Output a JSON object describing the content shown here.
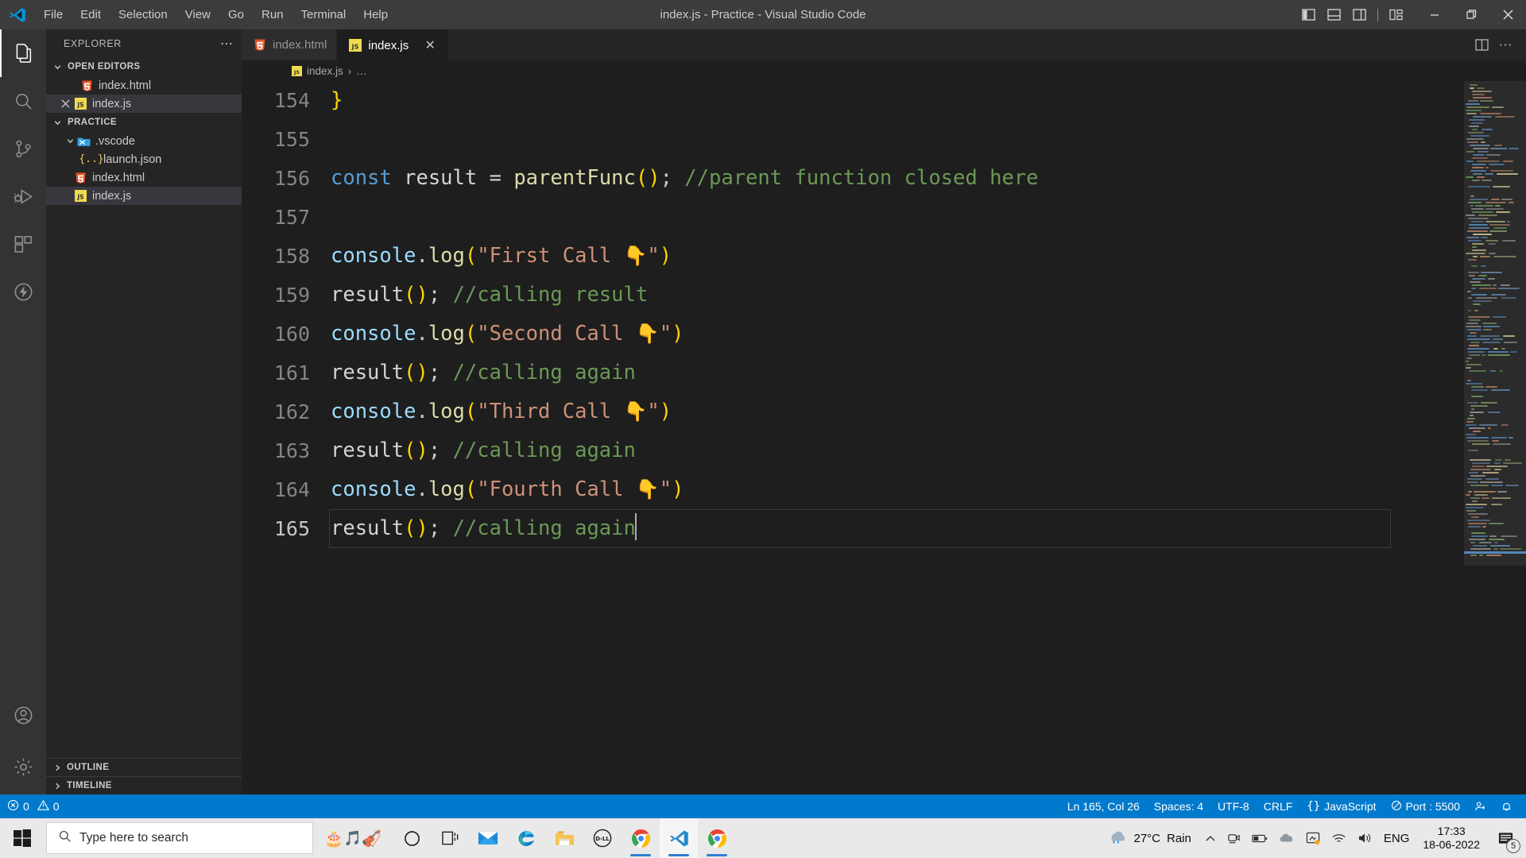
{
  "window": {
    "title": "index.js - Practice - Visual Studio Code",
    "logo_icon": "vscode-logo-icon",
    "menus": [
      "File",
      "Edit",
      "Selection",
      "View",
      "Go",
      "Run",
      "Terminal",
      "Help"
    ],
    "layout_buttons": [
      {
        "name": "toggle-primary-sidebar-icon",
        "label": "panel-left"
      },
      {
        "name": "toggle-panel-icon",
        "label": "panel-bottom"
      },
      {
        "name": "toggle-secondary-sidebar-icon",
        "label": "panel-right"
      },
      {
        "name": "customize-layout-icon",
        "label": "layout"
      }
    ],
    "controls": [
      {
        "name": "minimize-button",
        "glyph": "—"
      },
      {
        "name": "maximize-button",
        "glyph": "❐"
      },
      {
        "name": "close-button",
        "glyph": "✕"
      }
    ]
  },
  "activitybar": {
    "items": [
      {
        "name": "explorer",
        "icon": "files-icon",
        "active": true
      },
      {
        "name": "search",
        "icon": "search-icon",
        "active": false
      },
      {
        "name": "source-control",
        "icon": "source-control-icon",
        "active": false
      },
      {
        "name": "run-and-debug",
        "icon": "run-debug-icon",
        "active": false
      },
      {
        "name": "extensions",
        "icon": "extensions-icon",
        "active": false
      },
      {
        "name": "live-share",
        "icon": "bolt-circle-icon",
        "active": false
      }
    ],
    "bottom": [
      {
        "name": "accounts",
        "icon": "account-icon"
      },
      {
        "name": "manage-settings",
        "icon": "gear-icon"
      }
    ]
  },
  "sidebar": {
    "title": "EXPLORER",
    "more_actions": "⋯",
    "open_editors": {
      "label": "OPEN EDITORS",
      "expanded": true,
      "items": [
        {
          "name": "index.html",
          "icon": "html5-icon",
          "dirty": false,
          "selected": false,
          "has_close": false
        },
        {
          "name": "index.js",
          "icon": "js-icon",
          "dirty": false,
          "selected": true,
          "has_close": true
        }
      ]
    },
    "project": {
      "label": "PRACTICE",
      "expanded": true,
      "items": [
        {
          "name": ".vscode",
          "icon": "folder-open-icon",
          "type": "folder",
          "depth": 1,
          "expanded": true,
          "selected": false
        },
        {
          "name": "launch.json",
          "icon": "json-icon",
          "type": "file",
          "depth": 2,
          "selected": false
        },
        {
          "name": "index.html",
          "icon": "html5-icon",
          "type": "file",
          "depth": 1,
          "selected": false
        },
        {
          "name": "index.js",
          "icon": "js-icon",
          "type": "file",
          "depth": 1,
          "selected": true
        }
      ]
    },
    "panels": [
      {
        "label": "OUTLINE",
        "expanded": false
      },
      {
        "label": "TIMELINE",
        "expanded": false
      }
    ]
  },
  "editor": {
    "tabs": [
      {
        "label": "index.html",
        "icon": "html5-icon",
        "active": false,
        "has_close": false
      },
      {
        "label": "index.js",
        "icon": "js-icon",
        "active": true,
        "has_close": true,
        "close_glyph": "✕"
      }
    ],
    "tab_actions": [
      {
        "name": "split-editor-right-icon"
      },
      {
        "name": "more-actions-icon",
        "glyph": "⋯"
      }
    ],
    "breadcrumbs": [
      {
        "label": "index.js",
        "icon": "js-icon"
      },
      {
        "label": "…",
        "icon": null
      }
    ],
    "breadcrumb_separator": "›",
    "first_visible_line": 154,
    "cursor_line": 165,
    "lines": [
      {
        "n": 154,
        "tokens": [
          {
            "t": "brace",
            "v": "}"
          }
        ]
      },
      {
        "n": 155,
        "tokens": []
      },
      {
        "n": 156,
        "tokens": [
          {
            "t": "key",
            "v": "const"
          },
          {
            "t": "plain",
            "v": " "
          },
          {
            "t": "plain",
            "v": "result"
          },
          {
            "t": "plain",
            "v": " = "
          },
          {
            "t": "fn",
            "v": "parentFunc"
          },
          {
            "t": "paren",
            "v": "()"
          },
          {
            "t": "punc",
            "v": ";"
          },
          {
            "t": "plain",
            "v": " "
          },
          {
            "t": "cmt",
            "v": "//parent function closed here"
          }
        ]
      },
      {
        "n": 157,
        "tokens": []
      },
      {
        "n": 158,
        "tokens": [
          {
            "t": "var",
            "v": "console"
          },
          {
            "t": "punc",
            "v": "."
          },
          {
            "t": "prop",
            "v": "log"
          },
          {
            "t": "paren",
            "v": "("
          },
          {
            "t": "str",
            "v": "\"First Call "
          },
          {
            "t": "emoji",
            "v": "👇"
          },
          {
            "t": "str",
            "v": "\""
          },
          {
            "t": "paren",
            "v": ")"
          }
        ]
      },
      {
        "n": 159,
        "tokens": [
          {
            "t": "plain",
            "v": "result"
          },
          {
            "t": "paren",
            "v": "()"
          },
          {
            "t": "punc",
            "v": ";"
          },
          {
            "t": "plain",
            "v": " "
          },
          {
            "t": "cmt",
            "v": "//calling result"
          }
        ]
      },
      {
        "n": 160,
        "tokens": [
          {
            "t": "var",
            "v": "console"
          },
          {
            "t": "punc",
            "v": "."
          },
          {
            "t": "prop",
            "v": "log"
          },
          {
            "t": "paren",
            "v": "("
          },
          {
            "t": "str",
            "v": "\"Second Call "
          },
          {
            "t": "emoji",
            "v": "👇"
          },
          {
            "t": "str",
            "v": "\""
          },
          {
            "t": "paren",
            "v": ")"
          }
        ]
      },
      {
        "n": 161,
        "tokens": [
          {
            "t": "plain",
            "v": "result"
          },
          {
            "t": "paren",
            "v": "()"
          },
          {
            "t": "punc",
            "v": ";"
          },
          {
            "t": "plain",
            "v": " "
          },
          {
            "t": "cmt",
            "v": "//calling again"
          }
        ]
      },
      {
        "n": 162,
        "tokens": [
          {
            "t": "var",
            "v": "console"
          },
          {
            "t": "punc",
            "v": "."
          },
          {
            "t": "prop",
            "v": "log"
          },
          {
            "t": "paren",
            "v": "("
          },
          {
            "t": "str",
            "v": "\"Third Call "
          },
          {
            "t": "emoji",
            "v": "👇"
          },
          {
            "t": "str",
            "v": "\""
          },
          {
            "t": "paren",
            "v": ")"
          }
        ]
      },
      {
        "n": 163,
        "tokens": [
          {
            "t": "plain",
            "v": "result"
          },
          {
            "t": "paren",
            "v": "()"
          },
          {
            "t": "punc",
            "v": ";"
          },
          {
            "t": "plain",
            "v": " "
          },
          {
            "t": "cmt",
            "v": "//calling again"
          }
        ]
      },
      {
        "n": 164,
        "tokens": [
          {
            "t": "var",
            "v": "console"
          },
          {
            "t": "punc",
            "v": "."
          },
          {
            "t": "prop",
            "v": "log"
          },
          {
            "t": "paren",
            "v": "("
          },
          {
            "t": "str",
            "v": "\"Fourth Call "
          },
          {
            "t": "emoji",
            "v": "👇"
          },
          {
            "t": "str",
            "v": "\""
          },
          {
            "t": "paren",
            "v": ")"
          }
        ]
      },
      {
        "n": 165,
        "tokens": [
          {
            "t": "plain",
            "v": "result"
          },
          {
            "t": "paren",
            "v": "()"
          },
          {
            "t": "punc",
            "v": ";"
          },
          {
            "t": "plain",
            "v": " "
          },
          {
            "t": "cmt",
            "v": "//calling again"
          },
          {
            "t": "caret",
            "v": ""
          }
        ]
      }
    ]
  },
  "statusbar": {
    "errors": "0",
    "warnings": "0",
    "position": "Ln 165, Col 26",
    "indentation": "Spaces: 4",
    "encoding": "UTF-8",
    "eol": "CRLF",
    "language": "JavaScript",
    "live_server": "Port : 5500",
    "remote_icon": "remote-window-icon",
    "bell_icon": "bell-icon"
  },
  "taskbar": {
    "start_icon": "windows-start-icon",
    "search_placeholder": "Type here to search",
    "search_icon": "search-icon",
    "pinned": [
      {
        "name": "cortana-icon",
        "glyph": "◯"
      },
      {
        "name": "task-view-icon",
        "glyph": "task-view"
      },
      {
        "name": "mail-icon",
        "glyph": "✉"
      },
      {
        "name": "microsoft-edge-icon",
        "glyph": "edge"
      },
      {
        "name": "file-explorer-icon",
        "glyph": "folder"
      },
      {
        "name": "dell-icon",
        "glyph": "DELL"
      },
      {
        "name": "google-chrome-icon",
        "glyph": "chrome",
        "running": true
      },
      {
        "name": "visual-studio-code-icon",
        "glyph": "vscode",
        "running": true,
        "active": true
      },
      {
        "name": "google-chrome-icon-2",
        "glyph": "chrome",
        "running": true
      }
    ],
    "decor_emoji": [
      "🎂",
      "🎵",
      "🎻"
    ],
    "tray": {
      "weather_icon": "rain-cloud-icon",
      "temperature": "27°C",
      "condition": "Rain",
      "chevron": "∧",
      "icons": [
        {
          "name": "webcam-icon"
        },
        {
          "name": "battery-icon"
        },
        {
          "name": "onedrive-icon"
        },
        {
          "name": "intel-graphics-icon"
        },
        {
          "name": "wifi-icon"
        },
        {
          "name": "volume-icon"
        }
      ],
      "language": "ENG",
      "time": "17:33",
      "date": "18-06-2022",
      "notification_icon": "action-center-icon",
      "notification_count": "5"
    }
  },
  "colors": {
    "accent": "#007acc",
    "titlebar": "#3c3c3c",
    "activitybar": "#333333",
    "sidebar": "#252526",
    "editor": "#1e1e1e",
    "taskbar": "#e9e9e9"
  }
}
